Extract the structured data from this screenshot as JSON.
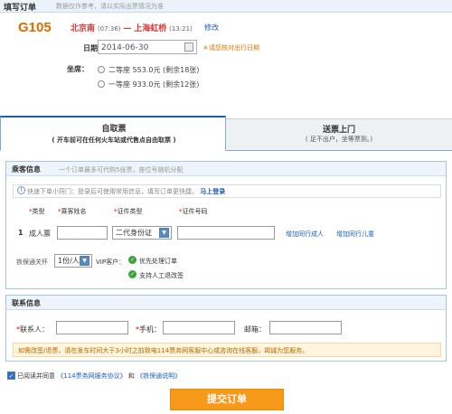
{
  "header": {
    "title": "填写订单",
    "hint": "数据仅作参考，请以实际出票情况为准"
  },
  "trip": {
    "train_no": "G105",
    "from_station": "北京南",
    "from_time": "(07:36)",
    "separator": "—",
    "to_station": "上海虹桥",
    "to_time": "(13:21)",
    "modify_label": "修改"
  },
  "date": {
    "label": "日期：",
    "value": "2014-06-30",
    "note": "＊请您核对出行日期"
  },
  "seat": {
    "label": "坐席：",
    "options": [
      {
        "label": "二等座 553.0元",
        "remaining": "(剩余18张)"
      },
      {
        "label": "一等座 933.0元",
        "remaining": "(剩余12张)"
      }
    ]
  },
  "tabs": [
    {
      "title": "自取票",
      "subtitle": "( 开车前可在任何火车站或代售点自由取票 )"
    },
    {
      "title": "送票上门",
      "subtitle": "( 足不出户，坐等票到。)"
    }
  ],
  "passengers": {
    "title": "乘客信息",
    "subtitle": "一个订单最多可代购5张票，座位号随机分配",
    "tip": "快速下单小窍门：登录后可使用常用信息，填写订单更快捷。",
    "login_link": "马上登录",
    "columns": [
      "类型",
      "乘客姓名",
      "证件类型",
      "证件号码"
    ],
    "row": {
      "index": "1",
      "type": "成人票",
      "name_value": "",
      "id_type": "二代身份证",
      "id_number": ""
    },
    "add_adult": "增加同行成人",
    "add_child": "增加同行儿童",
    "insurance_label": "铁保通关怀",
    "insurance_value": "1份/人",
    "vip_label": "VIP客户：",
    "vip_items": [
      "优先处理订单",
      "支持人工退改签"
    ]
  },
  "contact": {
    "title": "联系信息",
    "name_label": "联系人：",
    "phone_label": "手机：",
    "email_label": "邮箱：",
    "name_value": "",
    "phone_value": "",
    "email_value": ""
  },
  "notice": "如需改签/退票，请在发车时间大于3小时之前致电114票务网客服中心或咨询在线客服，竭诚为您服务。",
  "agreement": {
    "prefix": "已阅读并同意",
    "doc1": "《114票务网服务协议》",
    "and": "和",
    "doc2": "《铁保通说明》"
  },
  "submit_label": "提交订单",
  "colors": {
    "accent": "#1a5eb8",
    "train": "#e06a00",
    "submit": "#f79a1b",
    "check": "#3aa537"
  }
}
